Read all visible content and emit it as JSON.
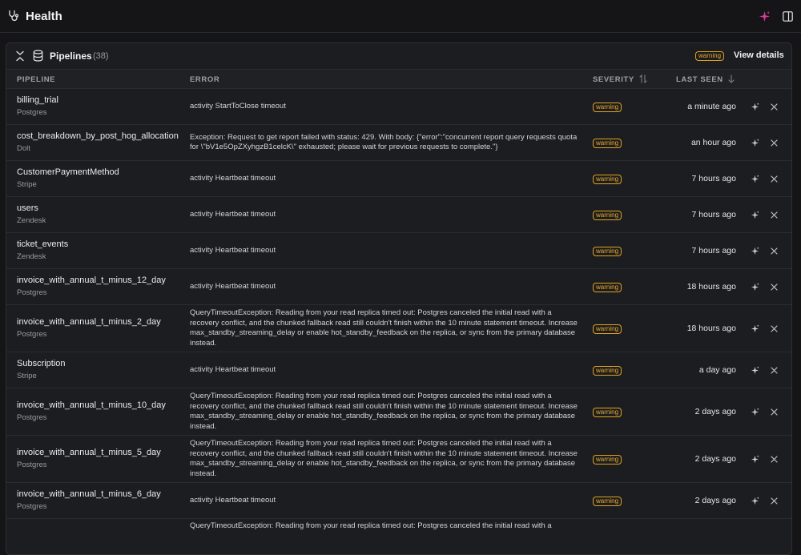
{
  "header": {
    "title": "Health",
    "app_icon": "stethoscope-icon",
    "right_icons": [
      "sparkle-icon",
      "side-panel-icon"
    ]
  },
  "colors": {
    "accent": "#e0389c",
    "warning": "#e3a21a",
    "background": "#151517",
    "card": "#1c1d21"
  },
  "card": {
    "title": "Pipelines",
    "count": "(38)",
    "badge": "warning",
    "view_details": "View details",
    "icons": [
      "collapse-icon",
      "database-icon"
    ]
  },
  "columns": {
    "pipeline": "PIPELINE",
    "error": "ERROR",
    "severity": "SEVERITY",
    "last_seen": "LAST SEEN"
  },
  "rows": [
    {
      "name": "billing_trial",
      "source": "Postgres",
      "error": "activity StartToClose timeout",
      "severity": "warning",
      "last_seen": "a minute ago"
    },
    {
      "name": "cost_breakdown_by_post_hog_allocation",
      "source": "Dolt",
      "error": "Exception: Request to get report failed with status: 429. With body: {\"error\":\"concurrent report query requests quota for \\\"bV1e5OpZXyhgzB1celcK\\\" exhausted; please wait for previous requests to complete.\"}",
      "severity": "warning",
      "last_seen": "an hour ago"
    },
    {
      "name": "CustomerPaymentMethod",
      "source": "Stripe",
      "error": "activity Heartbeat timeout",
      "severity": "warning",
      "last_seen": "7 hours ago"
    },
    {
      "name": "users",
      "source": "Zendesk",
      "error": "activity Heartbeat timeout",
      "severity": "warning",
      "last_seen": "7 hours ago"
    },
    {
      "name": "ticket_events",
      "source": "Zendesk",
      "error": "activity Heartbeat timeout",
      "severity": "warning",
      "last_seen": "7 hours ago"
    },
    {
      "name": "invoice_with_annual_t_minus_12_day",
      "source": "Postgres",
      "error": "activity Heartbeat timeout",
      "severity": "warning",
      "last_seen": "18 hours ago"
    },
    {
      "name": "invoice_with_annual_t_minus_2_day",
      "source": "Postgres",
      "error": "QueryTimeoutException: Reading from your read replica timed out: Postgres canceled the initial read with a recovery conflict, and the chunked fallback read still couldn't finish within the 10 minute statement timeout. Increase max_standby_streaming_delay or enable hot_standby_feedback on the replica, or sync from the primary database instead.",
      "severity": "warning",
      "last_seen": "18 hours ago"
    },
    {
      "name": "Subscription",
      "source": "Stripe",
      "error": "activity Heartbeat timeout",
      "severity": "warning",
      "last_seen": "a day ago"
    },
    {
      "name": "invoice_with_annual_t_minus_10_day",
      "source": "Postgres",
      "error": "QueryTimeoutException: Reading from your read replica timed out: Postgres canceled the initial read with a recovery conflict, and the chunked fallback read still couldn't finish within the 10 minute statement timeout. Increase max_standby_streaming_delay or enable hot_standby_feedback on the replica, or sync from the primary database instead.",
      "severity": "warning",
      "last_seen": "2 days ago"
    },
    {
      "name": "invoice_with_annual_t_minus_5_day",
      "source": "Postgres",
      "error": "QueryTimeoutException: Reading from your read replica timed out: Postgres canceled the initial read with a recovery conflict, and the chunked fallback read still couldn't finish within the 10 minute statement timeout. Increase max_standby_streaming_delay or enable hot_standby_feedback on the replica, or sync from the primary database instead.",
      "severity": "warning",
      "last_seen": "2 days ago"
    },
    {
      "name": "invoice_with_annual_t_minus_6_day",
      "source": "Postgres",
      "error": "activity Heartbeat timeout",
      "severity": "warning",
      "last_seen": "2 days ago"
    },
    {
      "name": "",
      "source": "",
      "error": "QueryTimeoutException: Reading from your read replica timed out: Postgres canceled the initial read with a",
      "severity": "",
      "last_seen": ""
    }
  ],
  "row_icons": [
    "sparkle-icon",
    "close-icon"
  ]
}
